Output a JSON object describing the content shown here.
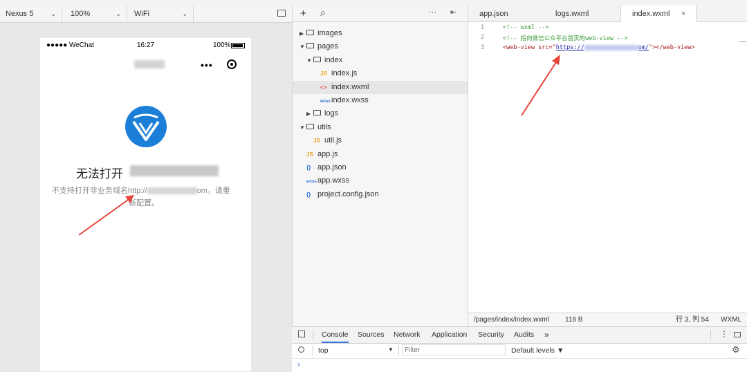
{
  "simulator": {
    "device": "Nexus 5",
    "zoom": "100%",
    "network": "WiFi",
    "statusbar": {
      "carrier": "●●●●● WeChat",
      "time": "16:27",
      "battery": "100%"
    },
    "error_title": "无法打开",
    "error_msg_1": "不支持打开非业务域名http://",
    "error_msg_tail": "om，请重",
    "error_msg_2": "新配置。"
  },
  "tree": {
    "items": [
      {
        "label": "images",
        "type": "folder",
        "depth": 0,
        "expanded": false
      },
      {
        "label": "pages",
        "type": "folder",
        "depth": 0,
        "expanded": true
      },
      {
        "label": "index",
        "type": "folder",
        "depth": 1,
        "expanded": true
      },
      {
        "label": "index.js",
        "type": "js",
        "depth": 2
      },
      {
        "label": "index.wxml",
        "type": "wxml",
        "depth": 2,
        "active": true
      },
      {
        "label": "index.wxss",
        "type": "wxss",
        "depth": 2
      },
      {
        "label": "logs",
        "type": "folder",
        "depth": 1,
        "expanded": false
      },
      {
        "label": "utils",
        "type": "folder",
        "depth": 0,
        "expanded": true
      },
      {
        "label": "util.js",
        "type": "js",
        "depth": 1
      },
      {
        "label": "app.js",
        "type": "js",
        "depth": 0
      },
      {
        "label": "app.json",
        "type": "json",
        "depth": 0
      },
      {
        "label": "app.wxss",
        "type": "wxss",
        "depth": 0
      },
      {
        "label": "project.config.json",
        "type": "json",
        "depth": 0
      }
    ]
  },
  "editor": {
    "tabs": [
      "app.json",
      "logs.wxml",
      "index.wxml"
    ],
    "active_tab": "index.wxml",
    "lines": [
      {
        "num": "1",
        "text": "<!-- wxml -->"
      },
      {
        "num": "2",
        "text": "<!-- 指向微信公众平台首页的web-view -->"
      },
      {
        "num": "3",
        "pre": "<web-view src=\"",
        "url": "https://",
        "url_tail": "om/",
        "post": "\"></web-view>"
      }
    ],
    "status": {
      "path": "/pages/index/index.wxml",
      "size": "118 B",
      "position": "行 3, 列 54",
      "lang": "WXML"
    }
  },
  "devtools": {
    "tabs": [
      "Console",
      "Sources",
      "Network",
      "Application",
      "Security",
      "Audits"
    ],
    "active_tab": "Console",
    "more": "»",
    "context": "top",
    "filter_placeholder": "Filter",
    "levels": "Default levels ▼",
    "prompt": "›"
  },
  "colors": {
    "arrow": "#e8443a",
    "logo": "#1b7fd8",
    "comment": "#3a9a3a",
    "tag": "#a31515",
    "link": "#1a1aa6"
  }
}
